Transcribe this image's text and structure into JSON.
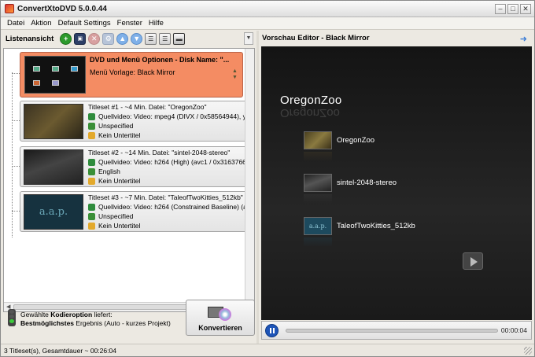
{
  "window": {
    "title": "ConvertXtoDVD 5.0.0.44"
  },
  "window_controls": {
    "minimize": "–",
    "maximize": "□",
    "close": "✕"
  },
  "menu": [
    "Datei",
    "Aktion",
    "Default Settings",
    "Fenster",
    "Hilfe"
  ],
  "left_panel": {
    "label": "Listenansicht",
    "toolbar_icons": [
      "add-icon",
      "save-icon",
      "delete-icon",
      "settings-icon",
      "move-up-icon",
      "move-down-icon",
      "view-list-icon",
      "view-details-icon",
      "view-compact-icon"
    ]
  },
  "menu_entry": {
    "title": "DVD und Menü Optionen - Disk Name: \"...",
    "template": "Menü Vorlage: Black Mirror"
  },
  "titlesets": [
    {
      "header": "Titleset #1 - ~4 Min. Datei: \"OregonZoo\"",
      "video": "Quellvideo: Video: mpeg4 (DIVX / 0x58564944), yu",
      "audio": "Unspecified",
      "subtitle": "Kein Untertitel"
    },
    {
      "header": "Titleset #2 - ~14 Min. Datei: \"sintel-2048-stereo\"",
      "video": "Quellvideo: Video: h264 (High) (avc1 / 0x3163766",
      "audio": "English",
      "subtitle": "Kein Untertitel"
    },
    {
      "header": "Titleset #3 - ~7 Min. Datei: \"TaleofTwoKitties_512kb\"",
      "video": "Quellvideo: Video: h264 (Constrained Baseline) (av",
      "audio": "Unspecified",
      "subtitle": "Kein Untertitel"
    }
  ],
  "encoding_status": {
    "prefix": "Gewählte ",
    "keyword": "Kodieroption",
    "suffix": " liefert:",
    "quality": "Bestmöglichstes",
    "quality_rest": " Ergebnis (Auto - kurzes Projekt)"
  },
  "convert_button": {
    "label": "Konvertieren"
  },
  "preview": {
    "title": "Vorschau Editor - Black Mirror",
    "heading": "OregonZoo",
    "items": [
      "OregonZoo",
      "sintel-2048-stereo",
      "TaleofTwoKitties_512kb"
    ],
    "time": "00:00:04"
  },
  "statusbar": {
    "text": "3 Titleset(s), Gesamtdauer ~ 00:26:04"
  }
}
